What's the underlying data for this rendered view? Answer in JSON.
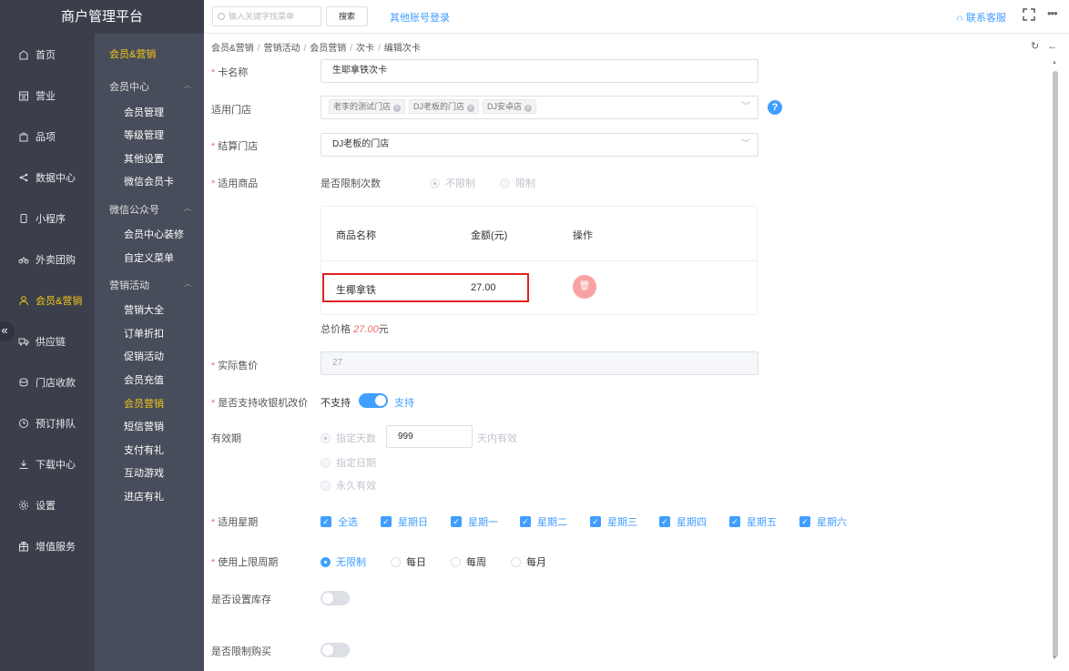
{
  "brand": "商户管理平台",
  "nav_primary": [
    {
      "label": "首页",
      "icon": "home-icon",
      "active": false
    },
    {
      "label": "营业",
      "icon": "calendar-icon",
      "active": false
    },
    {
      "label": "品项",
      "icon": "bag-icon",
      "active": false
    },
    {
      "label": "数据中心",
      "icon": "share-icon",
      "active": false
    },
    {
      "label": "小程序",
      "icon": "phone-icon",
      "active": false
    },
    {
      "label": "外卖团购",
      "icon": "bike-icon",
      "active": false
    },
    {
      "label": "会员&营销",
      "icon": "user-icon",
      "active": true
    },
    {
      "label": "供应链",
      "icon": "truck-icon",
      "active": false
    },
    {
      "label": "门店收款",
      "icon": "coin-icon",
      "active": false
    },
    {
      "label": "预订排队",
      "icon": "clock-icon",
      "active": false
    },
    {
      "label": "下载中心",
      "icon": "download-icon",
      "active": false
    },
    {
      "label": "设置",
      "icon": "gear-icon",
      "active": false
    },
    {
      "label": "增值服务",
      "icon": "gift-icon",
      "active": false
    }
  ],
  "nav_secondary": {
    "title": "会员&营销",
    "groups": [
      {
        "label": "会员中心",
        "items": [
          "会员管理",
          "等级管理",
          "其他设置",
          "微信会员卡"
        ]
      },
      {
        "label": "微信公众号",
        "items": [
          "会员中心装修",
          "自定义菜单"
        ]
      },
      {
        "label": "营销活动",
        "items": [
          "营销大全",
          "订单折扣",
          "促销活动",
          "会员充值",
          "会员营销",
          "短信营销",
          "支付有礼",
          "互动游戏",
          "进店有礼"
        ]
      }
    ],
    "active_item": "会员营销"
  },
  "topbar": {
    "search_placeholder": "输入关键字找菜单",
    "search_button": "搜索",
    "other_login": "其他账号登录",
    "customer_service": "联系客服",
    "more": "•••"
  },
  "breadcrumb": [
    "会员&营销",
    "营销活动",
    "会员营销",
    "次卡",
    "编辑次卡"
  ],
  "form": {
    "card_name": {
      "label": "卡名称",
      "value": "生耶拿铁次卡"
    },
    "stores": {
      "label": "适用门店",
      "tags": [
        "老李的测试门店",
        "DJ老板的门店",
        "DJ安卓店"
      ]
    },
    "settle_store": {
      "label": "结算门店",
      "value": "DJ老板的门店"
    },
    "products": {
      "label": "适用商品",
      "limit_label": "是否限制次数",
      "opt_unlimited": "不限制",
      "opt_limited": "限制"
    },
    "table": {
      "headers": [
        "商品名称",
        "金额(元)",
        "操作"
      ],
      "row": {
        "name": "生椰拿铁",
        "amount": "27.00"
      }
    },
    "total": {
      "prefix": "总价格",
      "value": "27.00",
      "suffix": "元"
    },
    "price": {
      "label": "实际售价",
      "value": "27"
    },
    "cashier": {
      "label": "是否支持收银机改价",
      "off": "不支持",
      "on": "支持"
    },
    "validity": {
      "label": "有效期",
      "opt_days": "指定天数",
      "days": "999",
      "days_suffix": "天内有效",
      "opt_date": "指定日期",
      "opt_forever": "永久有效"
    },
    "weekdays": {
      "label": "适用星期",
      "items": [
        "全选",
        "星期日",
        "星期一",
        "星期二",
        "星期三",
        "星期四",
        "星期五",
        "星期六"
      ]
    },
    "period": {
      "label": "使用上限周期",
      "items": [
        "无限制",
        "每日",
        "每周",
        "每月"
      ]
    },
    "stock": {
      "label": "是否设置库存"
    },
    "purchase": {
      "label": "是否限制购买"
    }
  }
}
